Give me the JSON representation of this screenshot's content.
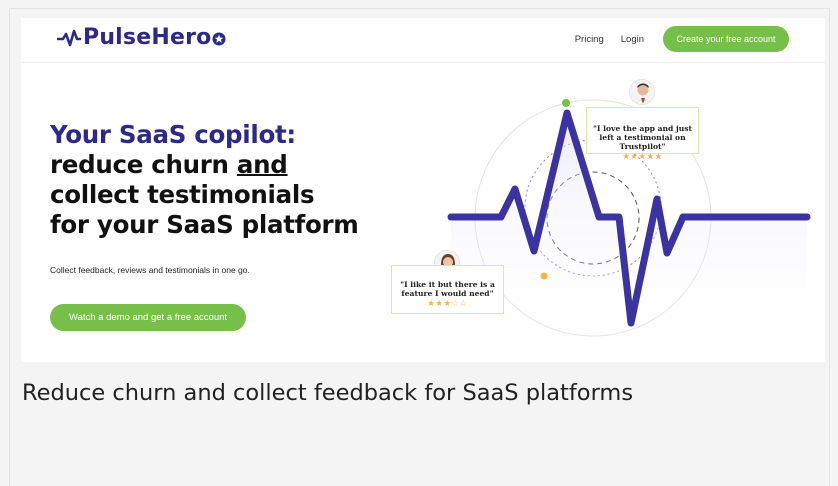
{
  "brand": {
    "name": "PulseHero",
    "color": "#2c2a86"
  },
  "nav": {
    "links": [
      "Pricing",
      "Login"
    ],
    "cta": "Create your free account"
  },
  "hero": {
    "title_accent": "Your SaaS copilot:",
    "title_line2_pre": "reduce churn ",
    "title_line2_underlined": "and",
    "title_line3": "collect testimonials",
    "title_line4": "for your SaaS platform",
    "subtitle": "Collect feedback, reviews and testimonials in one go.",
    "button": "Watch a demo and get a free account"
  },
  "testimonials": [
    {
      "text_line1": "\"I love the app and just",
      "text_line2": "left a testimonial on",
      "text_line3": "Trustpilot\"",
      "stars": "★★★★★",
      "rating": 5
    },
    {
      "text_line1": "\"I like it but there is a",
      "text_line2": "feature I would need\"",
      "stars": "★★★☆☆",
      "rating": 3
    }
  ],
  "caption": "Reduce churn and collect feedback for SaaS platforms",
  "colors": {
    "accent_green": "#76c04a",
    "brand_purple": "#2c2a86",
    "star_gold": "#f2b63f"
  }
}
